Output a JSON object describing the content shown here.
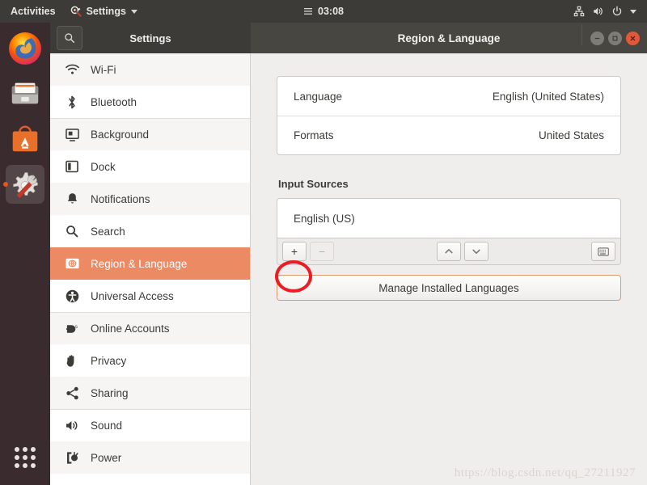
{
  "topbar": {
    "activities": "Activities",
    "app_menu": "Settings",
    "app_menu_icon": "settings-gear-wrench-icon",
    "clock": "03:08",
    "clock_icon": "calendar-list-icon",
    "icons": [
      "network-wired-icon",
      "volume-icon",
      "power-icon",
      "caret-down-icon"
    ]
  },
  "dock": {
    "items": [
      {
        "name": "firefox",
        "label": "Firefox",
        "active": false
      },
      {
        "name": "files",
        "label": "Files",
        "active": false
      },
      {
        "name": "ubuntu-software",
        "label": "Ubuntu Software",
        "active": false
      },
      {
        "name": "settings",
        "label": "Settings",
        "active": true
      }
    ],
    "app_grid_label": "Show Applications"
  },
  "window": {
    "sidebar_title": "Settings",
    "title": "Region & Language",
    "search_icon": "search-icon",
    "controls": {
      "minimize": "minimize-icon",
      "maximize": "maximize-icon",
      "close": "close-icon"
    }
  },
  "sidebar": {
    "items": [
      {
        "label": "Wi-Fi",
        "icon": "wifi-icon",
        "selected": false,
        "group_start": false
      },
      {
        "label": "Bluetooth",
        "icon": "bluetooth-icon",
        "selected": false,
        "group_start": false
      },
      {
        "label": "Background",
        "icon": "background-icon",
        "selected": false,
        "group_start": true
      },
      {
        "label": "Dock",
        "icon": "dock-icon",
        "selected": false,
        "group_start": false
      },
      {
        "label": "Notifications",
        "icon": "bell-icon",
        "selected": false,
        "group_start": false
      },
      {
        "label": "Search",
        "icon": "search-icon",
        "selected": false,
        "group_start": false
      },
      {
        "label": "Region & Language",
        "icon": "region-language-icon",
        "selected": true,
        "group_start": false
      },
      {
        "label": "Universal Access",
        "icon": "accessibility-icon",
        "selected": false,
        "group_start": false
      },
      {
        "label": "Online Accounts",
        "icon": "online-accounts-icon",
        "selected": false,
        "group_start": true
      },
      {
        "label": "Privacy",
        "icon": "hand-icon",
        "selected": false,
        "group_start": false
      },
      {
        "label": "Sharing",
        "icon": "share-icon",
        "selected": false,
        "group_start": false
      },
      {
        "label": "Sound",
        "icon": "sound-icon",
        "selected": false,
        "group_start": true
      },
      {
        "label": "Power",
        "icon": "power-plug-icon",
        "selected": false,
        "group_start": false
      }
    ]
  },
  "main": {
    "language_row": {
      "label": "Language",
      "value": "English (United States)"
    },
    "formats_row": {
      "label": "Formats",
      "value": "United States"
    },
    "input_sources": {
      "title": "Input Sources",
      "entries": [
        "English (US)"
      ],
      "toolbar": {
        "add": "+",
        "remove": "−",
        "move_up": "move-up-icon",
        "move_down": "move-down-icon",
        "keyboard_preview": "keyboard-icon"
      }
    },
    "manage_button": "Manage Installed Languages"
  },
  "annotation": {
    "target": "add-input-source-button",
    "shape": "red-ellipse",
    "color": "#EC1C24"
  },
  "watermark": "https://blog.csdn.net/qq_27211927",
  "colors": {
    "accent": "#E95420",
    "selected_row": "#EB8A63",
    "topbar": "#3C3B37",
    "panel": "#F0EEEC"
  }
}
